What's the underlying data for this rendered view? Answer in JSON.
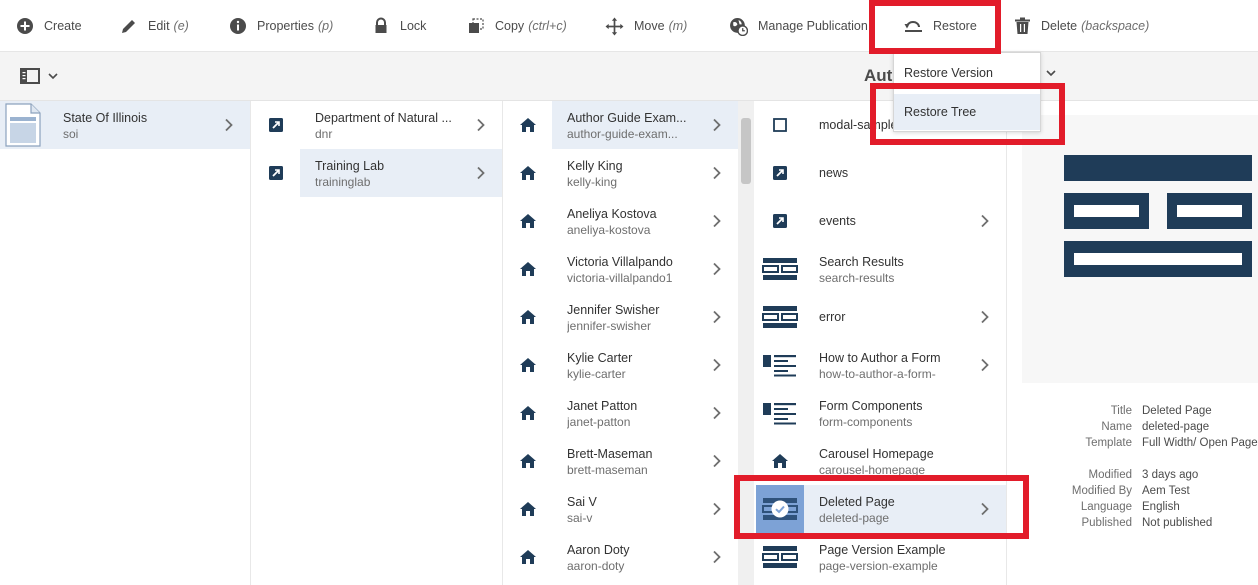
{
  "toolbar": {
    "create": "Create",
    "edit": "Edit",
    "edit_hint": "(e)",
    "properties": "Properties",
    "properties_hint": "(p)",
    "lock": "Lock",
    "copy": "Copy",
    "copy_hint": "(ctrl+c)",
    "move": "Move",
    "move_hint": "(m)",
    "manage_publication": "Manage Publication",
    "restore": "Restore",
    "delete": "Delete",
    "delete_hint": "(backspace)"
  },
  "subbar": {
    "title": "Auth"
  },
  "restore_menu": {
    "items": [
      {
        "label": "Restore Version"
      },
      {
        "label": "Restore Tree"
      }
    ]
  },
  "columns": {
    "col1": [
      {
        "title": "State Of Illinois",
        "name": "soi",
        "icon": "page-icon",
        "has_children": true,
        "selected": true
      }
    ],
    "col2": [
      {
        "title": "Department of Natural ...",
        "name": "dnr",
        "icon": "link-icon",
        "has_children": true,
        "selected": false
      },
      {
        "title": "Training Lab",
        "name": "traininglab",
        "icon": "link-icon",
        "has_children": true,
        "selected": true
      }
    ],
    "col3": [
      {
        "title": "Author Guide Exam...",
        "name": "author-guide-exam...",
        "icon": "home-icon",
        "has_children": true,
        "selected": true
      },
      {
        "title": "Kelly King",
        "name": "kelly-king",
        "icon": "home-icon",
        "has_children": true,
        "selected": false
      },
      {
        "title": "Aneliya Kostova",
        "name": "aneliya-kostova",
        "icon": "home-icon",
        "has_children": true,
        "selected": false
      },
      {
        "title": "Victoria Villalpando",
        "name": "victoria-villalpando1",
        "icon": "home-icon",
        "has_children": true,
        "selected": false
      },
      {
        "title": "Jennifer Swisher",
        "name": "jennifer-swisher",
        "icon": "home-icon",
        "has_children": true,
        "selected": false
      },
      {
        "title": "Kylie Carter",
        "name": "kylie-carter",
        "icon": "home-icon",
        "has_children": true,
        "selected": false
      },
      {
        "title": "Janet Patton",
        "name": "janet-patton",
        "icon": "home-icon",
        "has_children": true,
        "selected": false
      },
      {
        "title": "Brett-Maseman",
        "name": "brett-maseman",
        "icon": "home-icon",
        "has_children": true,
        "selected": false
      },
      {
        "title": "Sai V",
        "name": "sai-v",
        "icon": "home-icon",
        "has_children": true,
        "selected": false
      },
      {
        "title": "Aaron Doty",
        "name": "aaron-doty",
        "icon": "home-icon",
        "has_children": true,
        "selected": false
      }
    ],
    "col4": [
      {
        "title": "modal-sample",
        "name": "",
        "icon": "square-icon",
        "has_children": false,
        "selected": false
      },
      {
        "title": "news",
        "name": "",
        "icon": "link-icon",
        "has_children": false,
        "selected": false
      },
      {
        "title": "events",
        "name": "",
        "icon": "link-icon",
        "has_children": true,
        "selected": false
      },
      {
        "title": "Search Results",
        "name": "search-results",
        "icon": "layout-icon",
        "has_children": false,
        "selected": false
      },
      {
        "title": "error",
        "name": "",
        "icon": "layout-icon",
        "has_children": true,
        "selected": false
      },
      {
        "title": "How to Author a Form",
        "name": "how-to-author-a-form-",
        "icon": "list-layout-icon",
        "has_children": true,
        "selected": false
      },
      {
        "title": "Form Components",
        "name": "form-components",
        "icon": "list-layout-icon",
        "has_children": false,
        "selected": false
      },
      {
        "title": "Carousel Homepage",
        "name": "carousel-homepage",
        "icon": "home-icon",
        "has_children": false,
        "selected": false
      },
      {
        "title": "Deleted Page",
        "name": "deleted-page",
        "icon": "layout-icon",
        "has_children": true,
        "selected": true
      },
      {
        "title": "Page Version Example",
        "name": "page-version-example",
        "icon": "layout-icon",
        "has_children": false,
        "selected": false
      }
    ]
  },
  "preview": {
    "meta": [
      {
        "key": "Title",
        "value": "Deleted Page"
      },
      {
        "key": "Name",
        "value": "deleted-page"
      },
      {
        "key": "Template",
        "value": "Full Width/ Open Page"
      },
      {
        "key": "Modified",
        "value": "3 days ago"
      },
      {
        "key": "Modified By",
        "value": "Aem Test"
      },
      {
        "key": "Language",
        "value": "English"
      },
      {
        "key": "Published",
        "value": "Not published"
      }
    ]
  },
  "colors": {
    "accent_dark": "#1f3c58",
    "selection": "#e8eef6",
    "highlight_red": "#e21c2a",
    "check_blue": "#7da2d6"
  }
}
